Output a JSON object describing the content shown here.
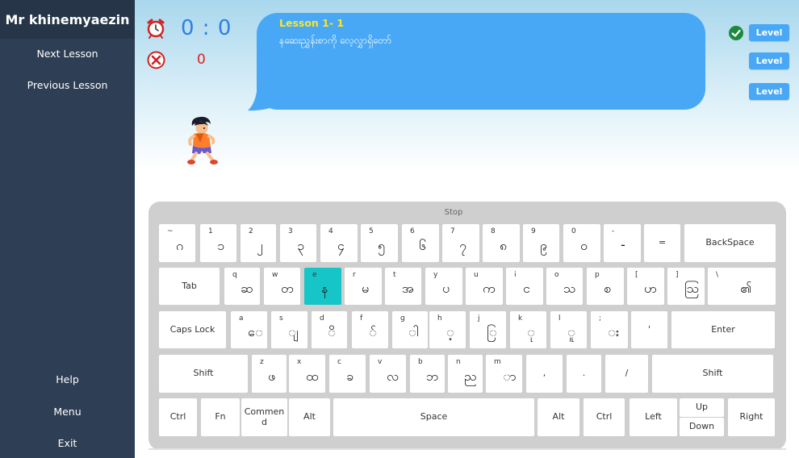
{
  "sidebar": {
    "title": "Mr khinemyaezin",
    "next_lesson": "Next Lesson",
    "previous_lesson": "Previous Lesson",
    "help": "Help",
    "menu": "Menu",
    "exit": "Exit"
  },
  "stats": {
    "time": "0 : 0",
    "errors": "0"
  },
  "lesson": {
    "title": "Lesson 1- 1",
    "text": "နဆေးညွှန်းစာကို လေ့လွှာရှိတော်"
  },
  "levels": [
    "Level",
    "Level",
    "Level"
  ],
  "keyboard": {
    "stop": "Stop",
    "row1": [
      {
        "en": "~",
        "my": "ဂ"
      },
      {
        "en": "1",
        "my": "၁"
      },
      {
        "en": "2",
        "my": "၂"
      },
      {
        "en": "3",
        "my": "၃"
      },
      {
        "en": "4",
        "my": "၄"
      },
      {
        "en": "5",
        "my": "၅"
      },
      {
        "en": "6",
        "my": "၆"
      },
      {
        "en": "7",
        "my": "၇"
      },
      {
        "en": "8",
        "my": "၈"
      },
      {
        "en": "9",
        "my": "၉"
      },
      {
        "en": "0",
        "my": "၀"
      },
      {
        "en": "-",
        "my": "-"
      },
      {
        "label": "="
      },
      {
        "label": "BackSpace"
      }
    ],
    "row2": [
      {
        "label": "Tab"
      },
      {
        "en": "q",
        "my": "ဆ"
      },
      {
        "en": "w",
        "my": "တ"
      },
      {
        "en": "e",
        "my": "န"
      },
      {
        "en": "r",
        "my": "မ"
      },
      {
        "en": "t",
        "my": "အ"
      },
      {
        "en": "y",
        "my": "ပ"
      },
      {
        "en": "u",
        "my": "က"
      },
      {
        "en": "i",
        "my": "င"
      },
      {
        "en": "o",
        "my": "သ"
      },
      {
        "en": "p",
        "my": "စ"
      },
      {
        "en": "[",
        "my": "ဟ"
      },
      {
        "en": "]",
        "my": "ဩ"
      },
      {
        "en": "\\",
        "my": "၏"
      }
    ],
    "row3": [
      {
        "label": "Caps Lock"
      },
      {
        "en": "a",
        "my": "ေ"
      },
      {
        "en": "s",
        "my": "ျ"
      },
      {
        "en": "d",
        "my": "ိ"
      },
      {
        "en": "f",
        "my": "်"
      },
      {
        "en": "g",
        "my": "ါ"
      },
      {
        "en": "h",
        "my": "့"
      },
      {
        "en": "j",
        "my": "ြ"
      },
      {
        "en": "k",
        "my": "ု"
      },
      {
        "en": "l",
        "my": "ူ"
      },
      {
        "en": ";",
        "my": "း"
      },
      {
        "label": "'"
      },
      {
        "label": "Enter"
      }
    ],
    "row4": [
      {
        "label": "Shift"
      },
      {
        "en": "z",
        "my": "ဖ"
      },
      {
        "en": "x",
        "my": "ထ"
      },
      {
        "en": "c",
        "my": "ခ"
      },
      {
        "en": "v",
        "my": "လ"
      },
      {
        "en": "b",
        "my": "ဘ"
      },
      {
        "en": "n",
        "my": "ည"
      },
      {
        "en": "m",
        "my": "ာ"
      },
      {
        "label": ","
      },
      {
        "label": "."
      },
      {
        "label": "/"
      },
      {
        "label": "Shift"
      }
    ],
    "row5": [
      {
        "label": "Ctrl"
      },
      {
        "label": "Fn"
      },
      {
        "label": "Commend"
      },
      {
        "label": "Alt"
      },
      {
        "label": "Space"
      },
      {
        "label": "Alt"
      },
      {
        "label": "Ctrl"
      },
      {
        "label": "Left"
      },
      {
        "label": "Up"
      },
      {
        "label": "Down"
      },
      {
        "label": "Right"
      }
    ],
    "active_key": "e"
  },
  "colors": {
    "sidebar": "#2e3e54",
    "bubble": "#49a8f5",
    "lesson_title": "#ffe61a",
    "active_key": "#16c5c8",
    "timer": "#2f7fe0",
    "error": "#e02020"
  }
}
